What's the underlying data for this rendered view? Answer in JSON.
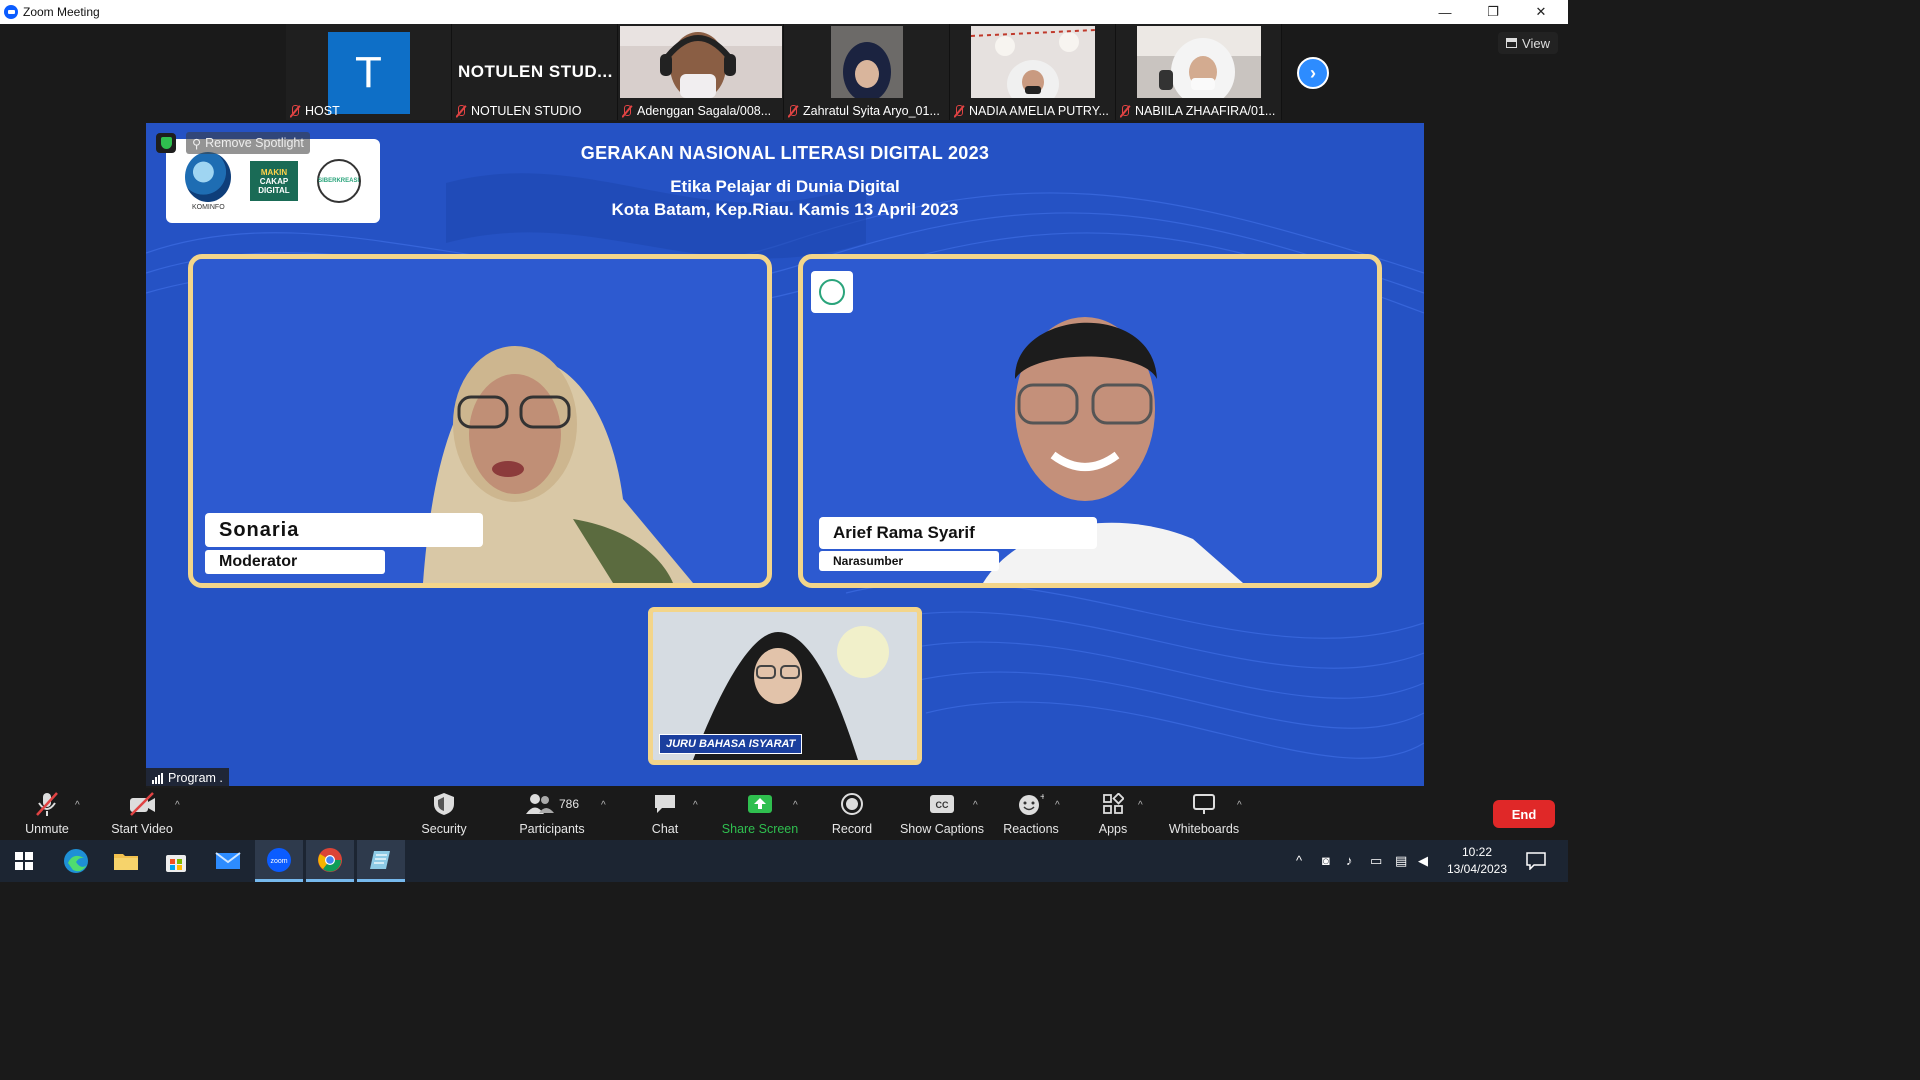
{
  "window": {
    "title": "Zoom Meeting",
    "controls": {
      "minimize": "—",
      "restore": "❐",
      "close": "✕"
    }
  },
  "strip": {
    "participants": [
      {
        "name": "HOST",
        "avatar_letter": "T",
        "video": false
      },
      {
        "name": "NOTULEN STUDIO",
        "tile_text": "NOTULEN  STUD...",
        "video": false
      },
      {
        "name": "Adenggan Sagala/008...",
        "video": true
      },
      {
        "name": "Zahratul Syita Aryo_01...",
        "video": true
      },
      {
        "name": "NADIA AMELIA PUTRY...",
        "video": true
      },
      {
        "name": "NABIILA ZHAAFIRA/01...",
        "video": true
      }
    ],
    "next_icon": "chevron-right-icon",
    "view_label": "View"
  },
  "stage": {
    "remove_spotlight": "Remove Spotlight",
    "logo_text": {
      "kominfo": "KOMINFO",
      "makin": "MAKIN",
      "cakap": "CAKAP",
      "digital": "DIGITAL",
      "siberkreasi": "SIBERKREASI"
    },
    "title": "GERAKAN NASIONAL LITERASI DIGITAL 2023",
    "subtitle1": "Etika Pelajar di Dunia Digital",
    "subtitle2": "Kota Batam, Kep.Riau. Kamis 13 April 2023",
    "left_panel": {
      "name": "Sonaria",
      "role": "Moderator"
    },
    "right_panel": {
      "name": "Arief Rama Syarif",
      "role": "Narasumber"
    },
    "bottom_panel": {
      "label": "JURU BAHASA ISYARAT"
    },
    "program_label": "Program ."
  },
  "toolbar": {
    "unmute": "Unmute",
    "start_video": "Start Video",
    "security": "Security",
    "participants": "Participants",
    "participants_count": "786",
    "chat": "Chat",
    "share_screen": "Share Screen",
    "record": "Record",
    "show_captions": "Show Captions",
    "reactions": "Reactions",
    "apps": "Apps",
    "whiteboards": "Whiteboards",
    "end": "End"
  },
  "taskbar": {
    "time": "10:22",
    "date": "13/04/2023",
    "apps": [
      "windows-start-icon",
      "edge-icon",
      "file-explorer-icon",
      "store-icon",
      "mail-icon",
      "zoom-icon",
      "chrome-icon",
      "notepad-icon"
    ]
  },
  "colors": {
    "stage_blue": "#2552c4",
    "frame_gold": "#f3d58a",
    "end_red": "#e02828",
    "share_green": "#2fbf4f",
    "zoom_blue": "#0b5cff"
  }
}
